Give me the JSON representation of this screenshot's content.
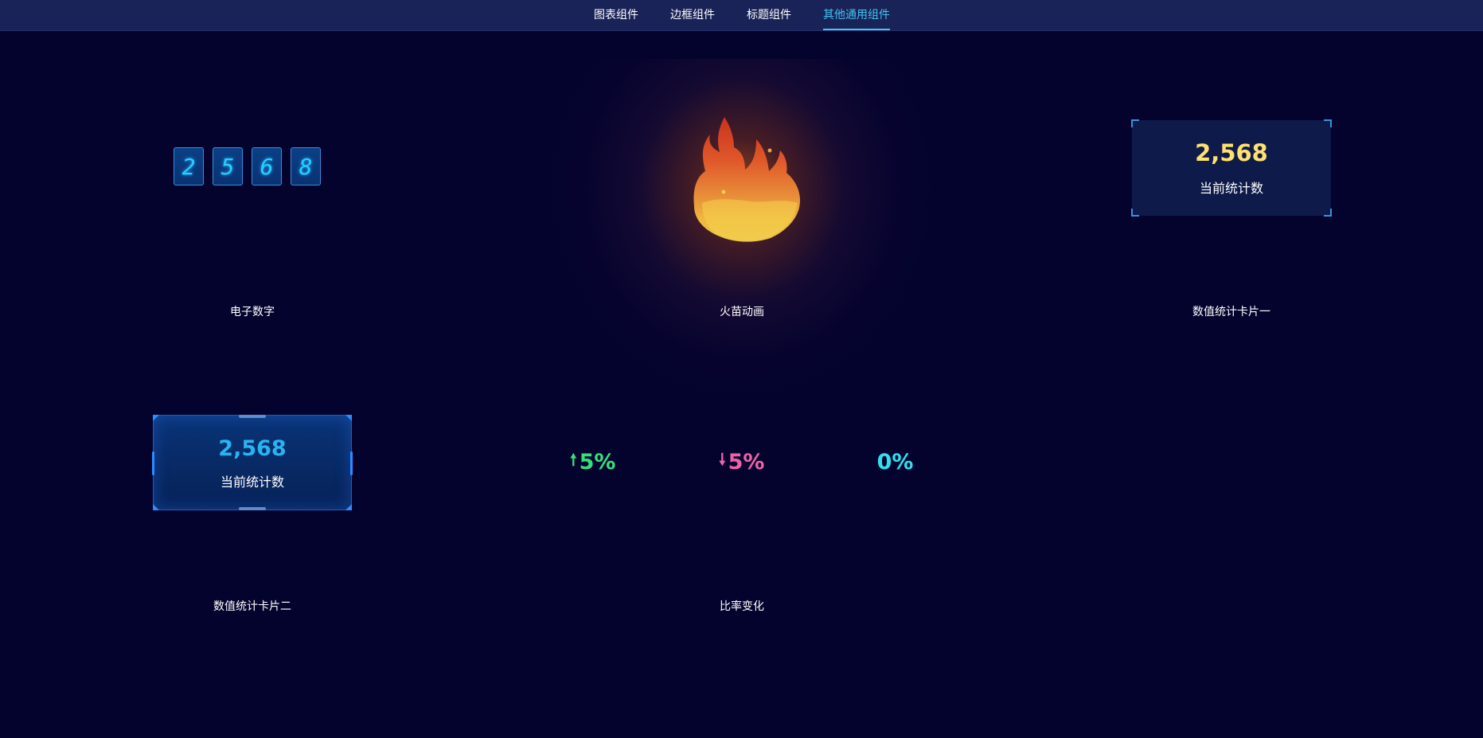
{
  "nav": {
    "tabs": [
      {
        "label": "图表组件",
        "active": false
      },
      {
        "label": "边框组件",
        "active": false
      },
      {
        "label": "标题组件",
        "active": false
      },
      {
        "label": "其他通用组件",
        "active": true
      }
    ]
  },
  "colors": {
    "background": "#04032e",
    "nav_background": "#1a2357",
    "active_tab": "#3ec5f2",
    "digit_text": "#27d0ff",
    "card1_value": "#ffe170",
    "card2_value": "#28b4f0",
    "rate_up": "#35e07b",
    "rate_down": "#f062a8",
    "rate_flat": "#2ee0f0"
  },
  "components": {
    "electronic_digits": {
      "digits": [
        "2",
        "5",
        "6",
        "8"
      ],
      "label": "电子数字"
    },
    "flame_animation": {
      "label": "火苗动画",
      "icon": "flame-icon"
    },
    "stat_card_one": {
      "value": "2,568",
      "caption": "当前统计数",
      "label": "数值统计卡片一"
    },
    "stat_card_two": {
      "value": "2,568",
      "caption": "当前统计数",
      "label": "数值统计卡片二"
    },
    "rate_change": {
      "label": "比率变化",
      "items": [
        {
          "direction": "up",
          "arrow": "🠕",
          "value": "5%"
        },
        {
          "direction": "down",
          "arrow": "🠗",
          "value": "5%"
        },
        {
          "direction": "flat",
          "arrow": "🠕",
          "value": "0%"
        }
      ]
    }
  }
}
